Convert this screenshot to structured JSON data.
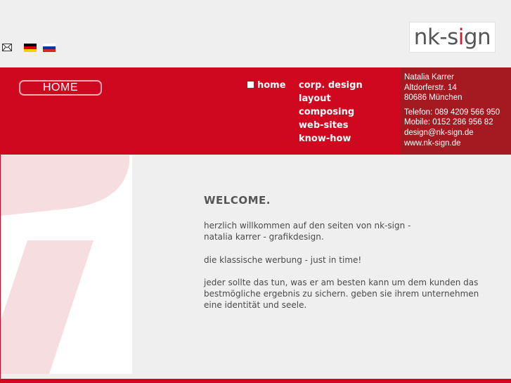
{
  "logo": {
    "prefix": "nk-s",
    "dot": "i",
    "suffix": "gn"
  },
  "icons": {
    "mail": "mail-icon",
    "flag_de": "flag-germany-icon",
    "flag_ru": "flag-russia-icon"
  },
  "header": {
    "badge": "HOME"
  },
  "nav": {
    "home": "home",
    "items": [
      "corp. design",
      "layout",
      "composing",
      "web-sites",
      "know-how"
    ]
  },
  "contact": {
    "name": "Natalia Karrer",
    "street": "Altdorferstr. 14",
    "city": "80686 München",
    "phone": "Telefon: 089 4209 566 950",
    "mobile": "Mobile: 0152 286 956 82",
    "email": "design@nk-sign.de",
    "web": "www.nk-sign.de"
  },
  "main": {
    "title": "WELCOME.",
    "p1_line1": "herzlich willkommen auf den seiten von nk-sign -",
    "p1_line2": "natalia karrer - grafikdesign.",
    "p2": "die klassische werbung - just in time!",
    "p3": "jeder sollte das tun, was er am besten kann um dem kunden das bestmögliche ergebnis zu sichern. geben sie ihrem unternehmen eine identität und seele."
  },
  "colors": {
    "brand_red": "#d0081f",
    "contact_red": "#a51a20",
    "deco_pink": "#f6dde0"
  }
}
